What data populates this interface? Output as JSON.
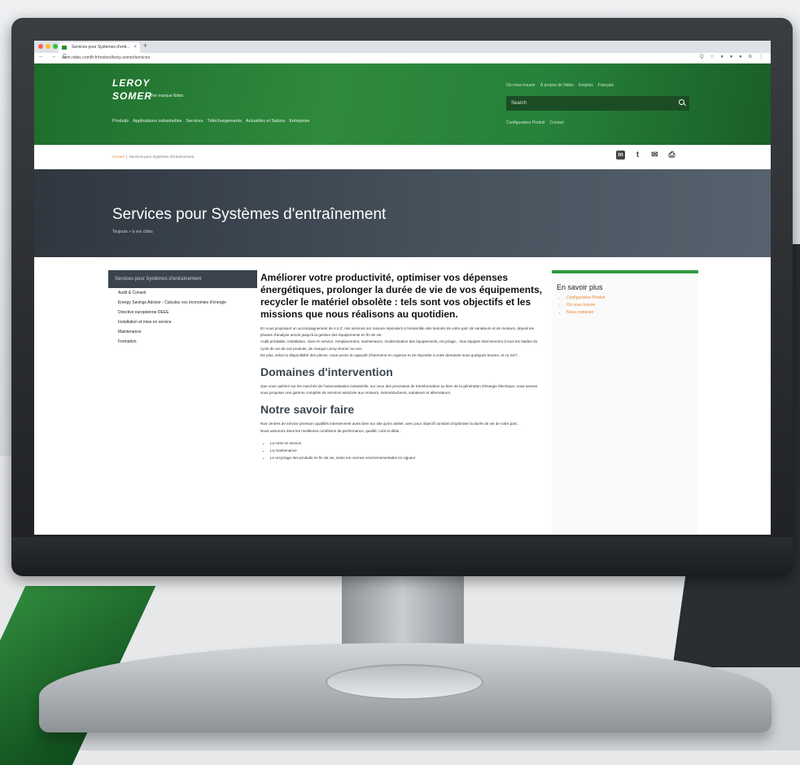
{
  "browser": {
    "tab_title": "Services pour Systèmes d'entr...",
    "tab_close": "×",
    "new_tab": "+",
    "url": "acim.nidec.com/fr-fr/motors/leroy-somer/services",
    "nav": "← → C",
    "toolbar_icons": "Q ☆ ● ● ● ⊖ ⋮"
  },
  "header": {
    "logo_line1": "LEROY",
    "logo_line2": "SOMER",
    "tagline": "Une marque Nidec",
    "nav": [
      "Produits",
      "Applications industrielles",
      "Services",
      "Téléchargements",
      "Actualités et Salons",
      "Entreprise"
    ],
    "util_links": [
      "Où nous trouver",
      "À propos de Nidec",
      "Emplois",
      "Français"
    ],
    "search_placeholder": "Search",
    "util_links2": [
      "Configurateur Produit",
      "Contact"
    ]
  },
  "breadcrumb": {
    "home": "Accueil",
    "current": "Services pour Systèmes d'entraînement"
  },
  "share": {
    "linkedin": "in",
    "twitter": "t",
    "mail": "✉",
    "print": "⎙"
  },
  "hero": {
    "title": "Services pour Systèmes d'entraînement",
    "subtitle": "Toujours » à vos côtés"
  },
  "sidebar": {
    "heading": "Services pour Systèmes d'entraînement",
    "items": [
      "Audit & Conseil",
      "Energy Savings Advisor - Calculez vos économies d'énergie",
      "Directive européenne DEEE",
      "Installation et mise en service",
      "Maintenance",
      "Formation"
    ]
  },
  "main": {
    "lead": "Améliorer votre productivité, optimiser vos dépenses énergétiques, prolonger la durée de vie de vos équipements, recycler le matériel obsolète : tels sont vos objectifs et les missions que nous réalisons au quotidien.",
    "p1": "En vous proposant un accompagnement de A à Z, nos services sur mesure répondent à l'ensemble des besoins de votre parc de variateurs et de moteurs, depuis les phases d'analyse amont jusqu'à la gestion des équipements en fin de vie.",
    "p2": "Audit préalable, installation, mise en service, remplacement, maintenance, modernisation des équipements, recyclage... Nos équipes interviennent à tous les stades du cycle de vie de vos produits, de marque Leroy-Somer ou non.",
    "p3": "De plus, selon la disponibilité des pièces, nous avons la capacité d'intervenir en urgence et de répondre à votre demande sous quelques heures, et ce 24/7.",
    "h2a": "Domaines d'intervention",
    "p4": "Que vous opériez sur les marchés de l'automatisation industrielle, sur ceux des processus de transformation ou bien de la génération d'énergie électrique, nous savons vous proposer une gamme complète de services associée aux moteurs, motoréducteurs, variateurs et alternateurs.",
    "h2b": "Notre savoir faire",
    "p5": "Nos centres de service premium qualifiés interviennent aussi bien sur site qu'en atelier, avec pour objectif constant d'optimiser la durée de vie de votre parc.",
    "p6": "Nous assurons dans les meilleures conditions de performance, qualité, coût et délai :",
    "bullets": [
      "La mise en service",
      "La maintenance",
      "Le recyclage des produits en fin de vie, selon les normes environnementales en vigueur"
    ]
  },
  "aside": {
    "title": "En savoir plus",
    "links": [
      "Configurateur Produit",
      "Où nous trouver",
      "Nous contacter"
    ]
  }
}
